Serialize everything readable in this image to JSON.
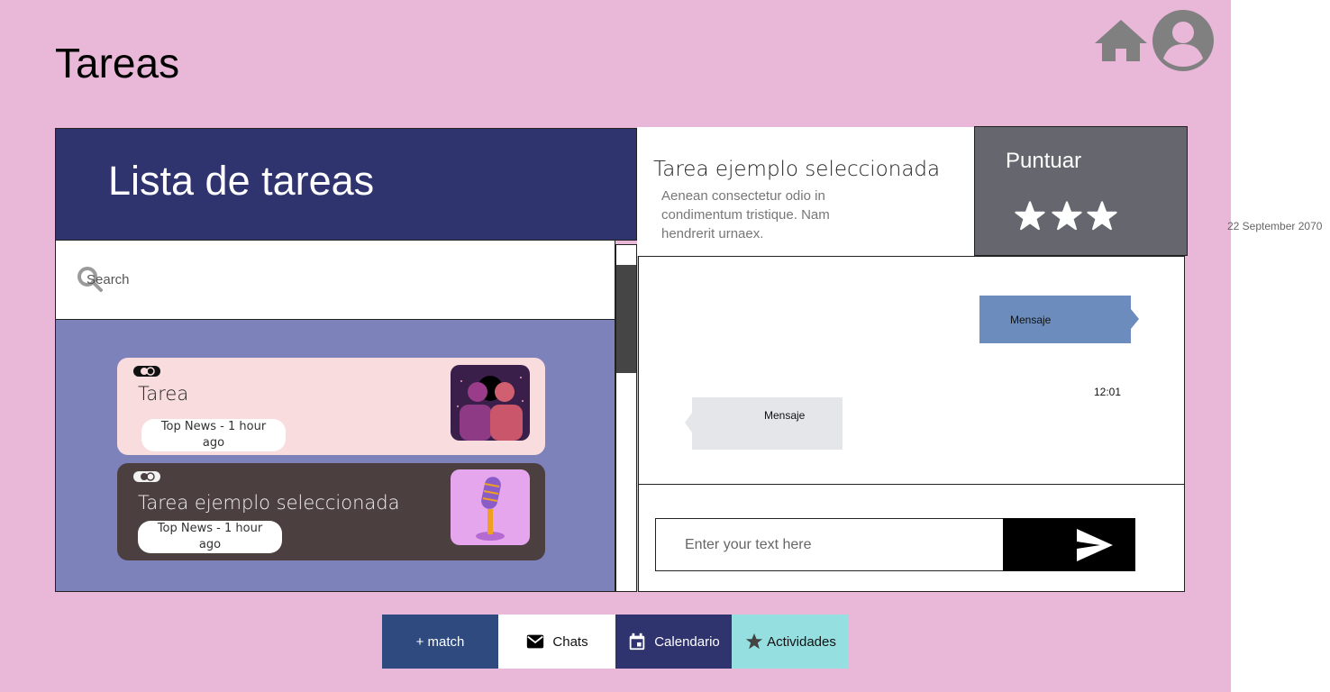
{
  "header": {
    "title": "Tareas"
  },
  "icons": {
    "home": "home-icon",
    "profile": "account-circle-icon"
  },
  "task_list": {
    "title": "Lista de tareas",
    "search": {
      "placeholder": "Search"
    },
    "cards": [
      {
        "title": "Tarea",
        "meta_line1": "Top News - 1 hour",
        "meta_line2": "ago",
        "thumbnail": "two-faces-silhouette-image"
      },
      {
        "title": "Tarea ejemplo seleccionada",
        "meta_line1": "Top News - 1 hour",
        "meta_line2": "ago",
        "thumbnail": "microphone-image"
      }
    ]
  },
  "selected_task": {
    "title": "Tarea ejemplo seleccionada",
    "description": "Aenean consectetur odio in condimentum tristique. Nam hendrerit urnaex."
  },
  "rating": {
    "title": "Puntuar",
    "stars": 3
  },
  "date": "22 September 2070",
  "chat": {
    "messages": [
      {
        "direction": "outgoing",
        "text": "Mensaje"
      },
      {
        "direction": "incoming",
        "text": "Mensaje"
      }
    ],
    "time": "12:01",
    "input_placeholder": "Enter your text here"
  },
  "nav": {
    "match": "+ match",
    "chats": "Chats",
    "calendar": "Calendario",
    "activities": "Actividades"
  },
  "colors": {
    "page_background": "#e9b7d7",
    "header_navy": "#30346e",
    "list_background": "#7d82ba",
    "rating_gray": "#66666f",
    "bubble_blue": "#6b8cbc",
    "nav_match": "#2e4a7e",
    "nav_activities": "#96dfe0"
  }
}
